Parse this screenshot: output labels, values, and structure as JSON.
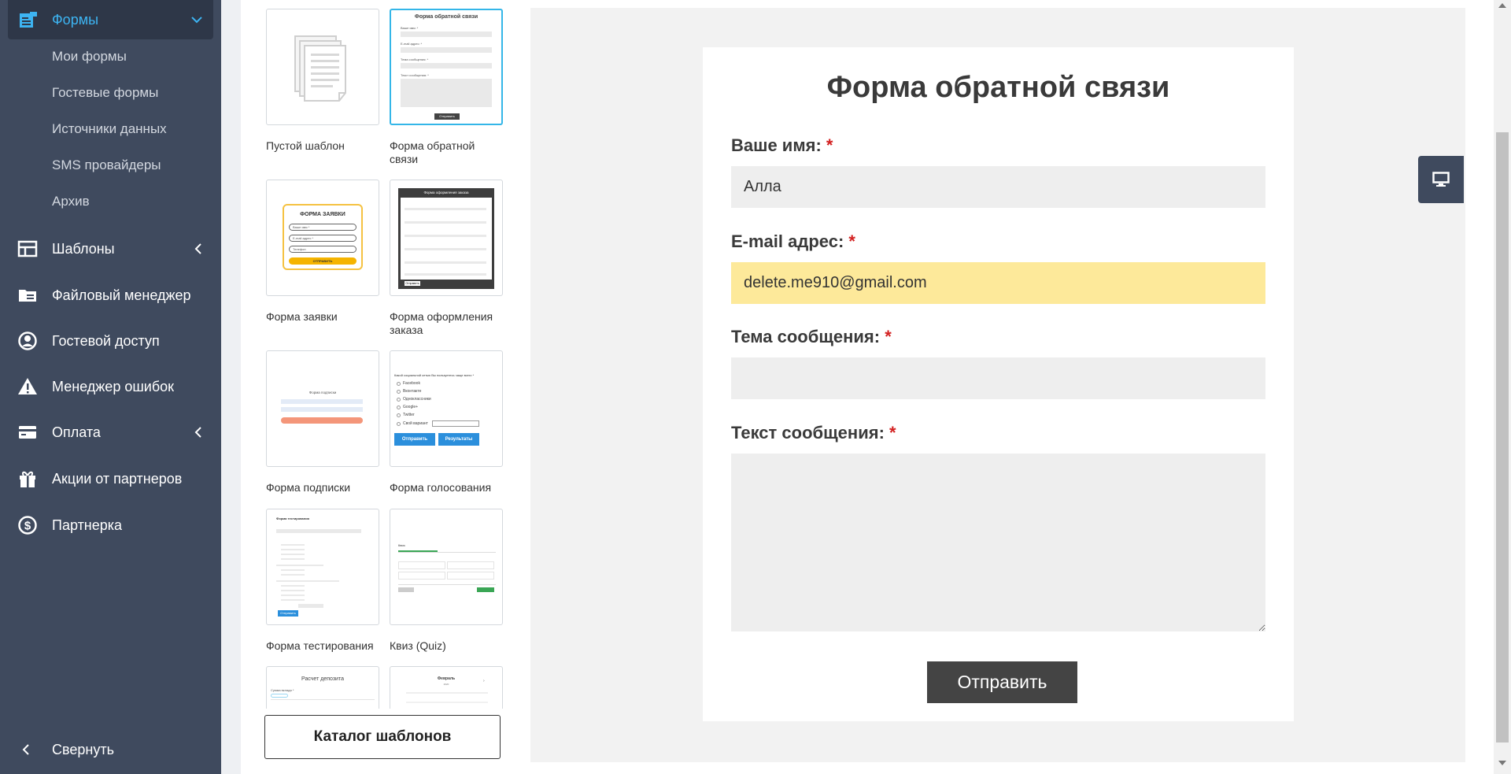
{
  "sidebar": {
    "active": {
      "label": "Формы"
    },
    "subitems": [
      "Мои формы",
      "Гостевые формы",
      "Источники данных",
      "SMS провайдеры",
      "Архив"
    ],
    "items": [
      {
        "label": "Шаблоны",
        "icon": "grid-icon",
        "has_chevron": true
      },
      {
        "label": "Файловый менеджер",
        "icon": "folder-icon",
        "has_chevron": false
      },
      {
        "label": "Гостевой доступ",
        "icon": "user-circle-icon",
        "has_chevron": false
      },
      {
        "label": "Менеджер ошибок",
        "icon": "warning-icon",
        "has_chevron": false
      },
      {
        "label": "Оплата",
        "icon": "card-icon",
        "has_chevron": true
      },
      {
        "label": "Акции от партнеров",
        "icon": "gift-icon",
        "has_chevron": false
      },
      {
        "label": "Партнерка",
        "icon": "dollar-icon",
        "has_chevron": false
      }
    ],
    "collapse_label": "Свернуть"
  },
  "templates": {
    "items": [
      "Пустой шаблон",
      "Форма обратной связи",
      "Форма заявки",
      "Форма оформления заказа",
      "Форма подписки",
      "Форма голосования",
      "Форма тестирования",
      "Квиз (Quiz)"
    ],
    "thumb_texts": {
      "feedback_title": "Форма обратной связи",
      "feedback_l1": "Ваше имя: *",
      "feedback_l2": "E-mail адрес: *",
      "feedback_l3": "Тема сообщения: *",
      "feedback_l4": "Текст сообщения: *",
      "feedback_btn": "Отправить",
      "request_title": "ФОРМА ЗАЯВКИ",
      "request_f1": "Ваше имя *",
      "request_f2": "E-mail адрес *",
      "request_f3": "Телефон",
      "request_btn": "ОТПРАВИТЬ",
      "order_title": "Форма оформления заказа",
      "order_btn": "Отправить",
      "subscribe_title": "Форма подписки",
      "vote_question": "Какой социальной сетью Вы пользуетесь чаще всего *",
      "vote_options": [
        "Facebook",
        "Вконтакте",
        "Одноклассники",
        "Google+",
        "Twitter",
        "Свой вариант"
      ],
      "vote_btn1": "Отправить",
      "vote_btn2": "Результаты",
      "test_title": "Форма тестирования",
      "test_btn": "Отправить",
      "quiz_title": "Квиз",
      "deposit_title": "Расчет депозита",
      "deposit_label": "Сумма вклада *",
      "calendar_title": "Февраль",
      "calendar_year": "2020"
    },
    "catalog_button": "Каталог шаблонов"
  },
  "preview": {
    "title": "Форма обратной связи",
    "fields": [
      {
        "label": "Ваше имя:",
        "value": "Алла"
      },
      {
        "label": "E-mail адрес:",
        "value": "delete.me910@gmail.com"
      },
      {
        "label": "Тема сообщения:",
        "value": ""
      }
    ],
    "textarea_label": "Текст сообщения:",
    "required_mark": "*",
    "submit_label": "Отправить"
  },
  "colors": {
    "sidebar_bg": "#3f4a5e",
    "active_accent": "#3db4f2",
    "autofill": "#fde99a",
    "required": "#d32020"
  }
}
